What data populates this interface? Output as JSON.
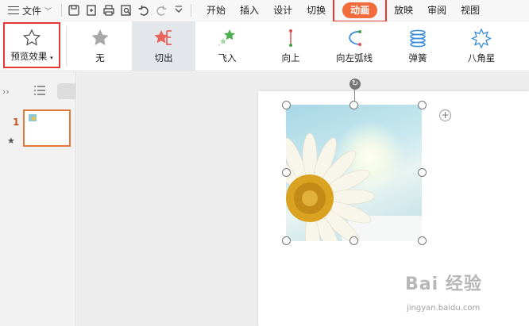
{
  "menu": {
    "file_label": "文件",
    "tabs": [
      {
        "label": "开始"
      },
      {
        "label": "插入"
      },
      {
        "label": "设计"
      },
      {
        "label": "切换"
      },
      {
        "label": "动画",
        "active": true
      },
      {
        "label": "放映"
      },
      {
        "label": "审阅"
      },
      {
        "label": "视图"
      }
    ]
  },
  "ribbon": {
    "preview_label": "预览效果",
    "effects": [
      {
        "label": "无",
        "icon": "star-gray-icon"
      },
      {
        "label": "切出",
        "icon": "cut-out-icon",
        "selected": true
      },
      {
        "label": "飞入",
        "icon": "fly-in-icon"
      },
      {
        "label": "向上",
        "icon": "upward-icon"
      },
      {
        "label": "向左弧线",
        "icon": "arc-left-icon"
      },
      {
        "label": "弹簧",
        "icon": "spring-icon"
      },
      {
        "label": "八角星",
        "icon": "octagram-icon"
      }
    ]
  },
  "slides_panel": {
    "slide_number": "1"
  },
  "watermark": {
    "text": "Bai 经验",
    "sub": "jingyan.baidu.com"
  },
  "colors": {
    "accent": "#f26b3a",
    "highlight_border": "#e53935",
    "thumb_border": "#e07a3c"
  }
}
